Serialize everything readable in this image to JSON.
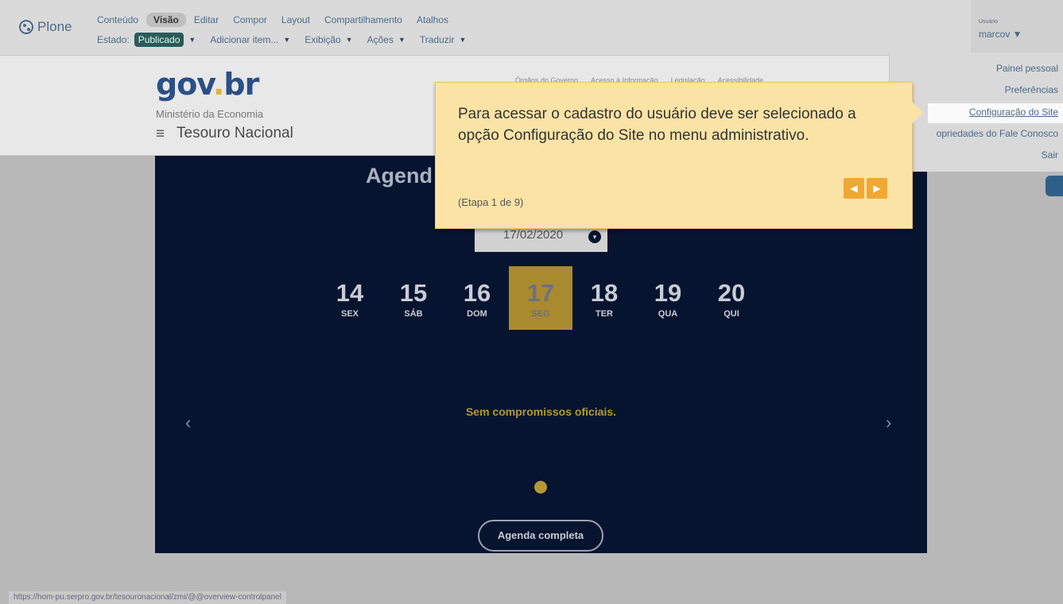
{
  "toolbar": {
    "logo": "Plone",
    "row1": [
      "Conteúdo",
      "Visão",
      "Editar",
      "Compor",
      "Layout",
      "Compartilhamento",
      "Atalhos"
    ],
    "state_label": "Estado:",
    "state_value": "Publicado",
    "row2": [
      "Adicionar item...",
      "Exibição",
      "Ações",
      "Traduzir"
    ],
    "dropdown_glyph": "▼",
    "user_caption": "Usuário",
    "user_name": "marcov ▼"
  },
  "header": {
    "logo_gov": "gov",
    "logo_dot": ".",
    "logo_br": "br",
    "ministry": "Ministério da Economia",
    "menu_icon": "≡",
    "site_title": "Tesouro Nacional",
    "top_links": [
      "Órgãos do Governo",
      "Acesso à Informação",
      "Legislação",
      "Acessibilidade"
    ]
  },
  "agenda": {
    "title": "Agend",
    "date": "17/02/2020",
    "calendar_icon": "▾",
    "days": [
      {
        "num": "14",
        "wd": "SEX"
      },
      {
        "num": "15",
        "wd": "SÁB"
      },
      {
        "num": "16",
        "wd": "DOM"
      },
      {
        "num": "17",
        "wd": "SEG"
      },
      {
        "num": "18",
        "wd": "TER"
      },
      {
        "num": "19",
        "wd": "QUA"
      },
      {
        "num": "20",
        "wd": "QUI"
      }
    ],
    "active_day": "17",
    "prev": "‹",
    "next": "›",
    "empty_message": "Sem compromissos oficiais.",
    "full_link": "Agenda completa"
  },
  "admin_menu": {
    "items": [
      "Painel pessoal",
      "Preferências",
      "Configuração do Site",
      "opriedades do Fale Conosco",
      "Sair"
    ]
  },
  "tour": {
    "text": "Para acessar o cadastro do usuário deve ser selecionado a opção Configuração do Site no menu administrativo.",
    "step": "(Etapa 1 de 9)",
    "prev": "◀",
    "next": "▶"
  },
  "status_url": "https://hom-pu.serpro.gov.br/tesouronacional/zmi/@@overview-controlpanel",
  "colors": {
    "agenda_bg": "#07142f",
    "accent_gold": "#b59735",
    "tour_bg": "#fbe3a6",
    "tour_button": "#f0a832"
  }
}
